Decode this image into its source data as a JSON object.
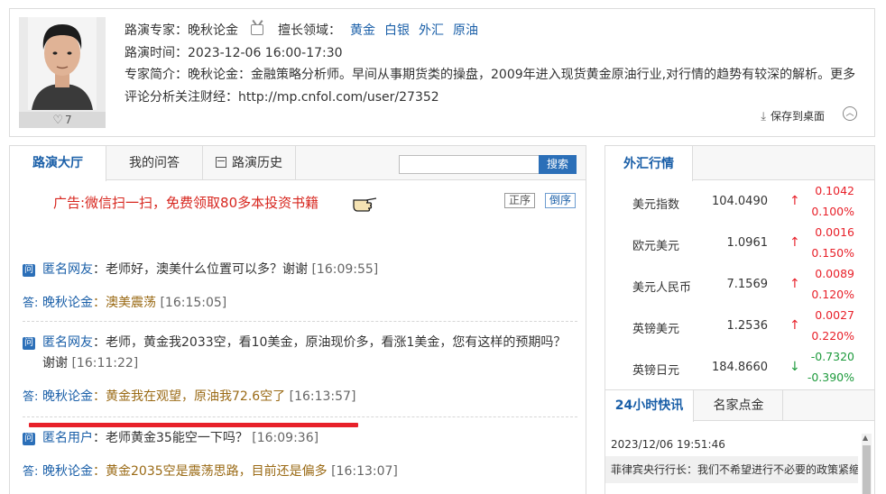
{
  "expert": {
    "like_count": "7",
    "host_label": "路演专家：晚秋论金",
    "field_label": "擅长领域：",
    "tags": [
      "黄金",
      "白银",
      "外汇",
      "原油"
    ],
    "time_text": "路演时间：2023-12-06 16:00-17:30",
    "intro_text": "专家简介：晚秋论金：金融策略分析师。早间从事期货类的操盘，2009年进入现货黄金原油行业,对行情的趋势有较深的解析。更多评论分析关注财经：http://mp.cnfol.com/user/27352",
    "save_label": "保存到桌面"
  },
  "main": {
    "tabs": [
      "路演大厅",
      "我的问答",
      "路演历史"
    ],
    "search": {
      "value": "",
      "button": "搜索"
    },
    "ad_text": "广告:微信扫一扫，免费领取80多本投资书籍",
    "order_asc": "正序",
    "order_desc": "倒序",
    "qa": [
      {
        "q_who": "匿名网友",
        "q_text": "：老师好，澳美什么位置可以多？谢谢",
        "q_time": "[16:09:55]",
        "a_prefix": "答",
        "a_who": "晚秋论金",
        "a_text": "：澳美震荡",
        "a_time": "[16:15:05]"
      },
      {
        "q_who": "匿名网友",
        "q_text": "：老师，黄金我2033空，看10美金，原油现价多，看涨1美金，您有这样的预期吗？谢谢",
        "q_time": "[16:11:22]",
        "a_prefix": "答",
        "a_who": "晚秋论金",
        "a_text": "：黄金我在观望，原油我72.6空了",
        "a_time": "[16:13:57]"
      },
      {
        "q_who": "匿名用户",
        "q_text": "：老师黄金35能空一下吗？",
        "q_time": "[16:09:36]",
        "a_prefix": "答",
        "a_who": "晚秋论金",
        "a_text": "：黄金2035空是震荡思路，目前还是偏多",
        "a_time": "[16:13:07]"
      }
    ]
  },
  "forex": {
    "title": "外汇行情",
    "rows": [
      {
        "name": "美元指数",
        "price": "104.0490",
        "arrow": "↑",
        "change": "0.1042",
        "pct": "0.100%",
        "dir": "up"
      },
      {
        "name": "欧元美元",
        "price": "1.0961",
        "arrow": "↑",
        "change": "0.0016",
        "pct": "0.150%",
        "dir": "up"
      },
      {
        "name": "美元人民币",
        "price": "7.1569",
        "arrow": "↑",
        "change": "0.0089",
        "pct": "0.120%",
        "dir": "up"
      },
      {
        "name": "英镑美元",
        "price": "1.2536",
        "arrow": "↑",
        "change": "0.0027",
        "pct": "0.220%",
        "dir": "up"
      },
      {
        "name": "英镑日元",
        "price": "184.8660",
        "arrow": "↓",
        "change": "-0.7320",
        "pct": "-0.390%",
        "dir": "down"
      }
    ]
  },
  "flash": {
    "tab_active": "24小时快讯",
    "tab_other": "名家点金",
    "time": "2023/12/06 19:51:46",
    "text": "菲律宾央行行长：我们不希望进行不必要的政策紧缩"
  }
}
